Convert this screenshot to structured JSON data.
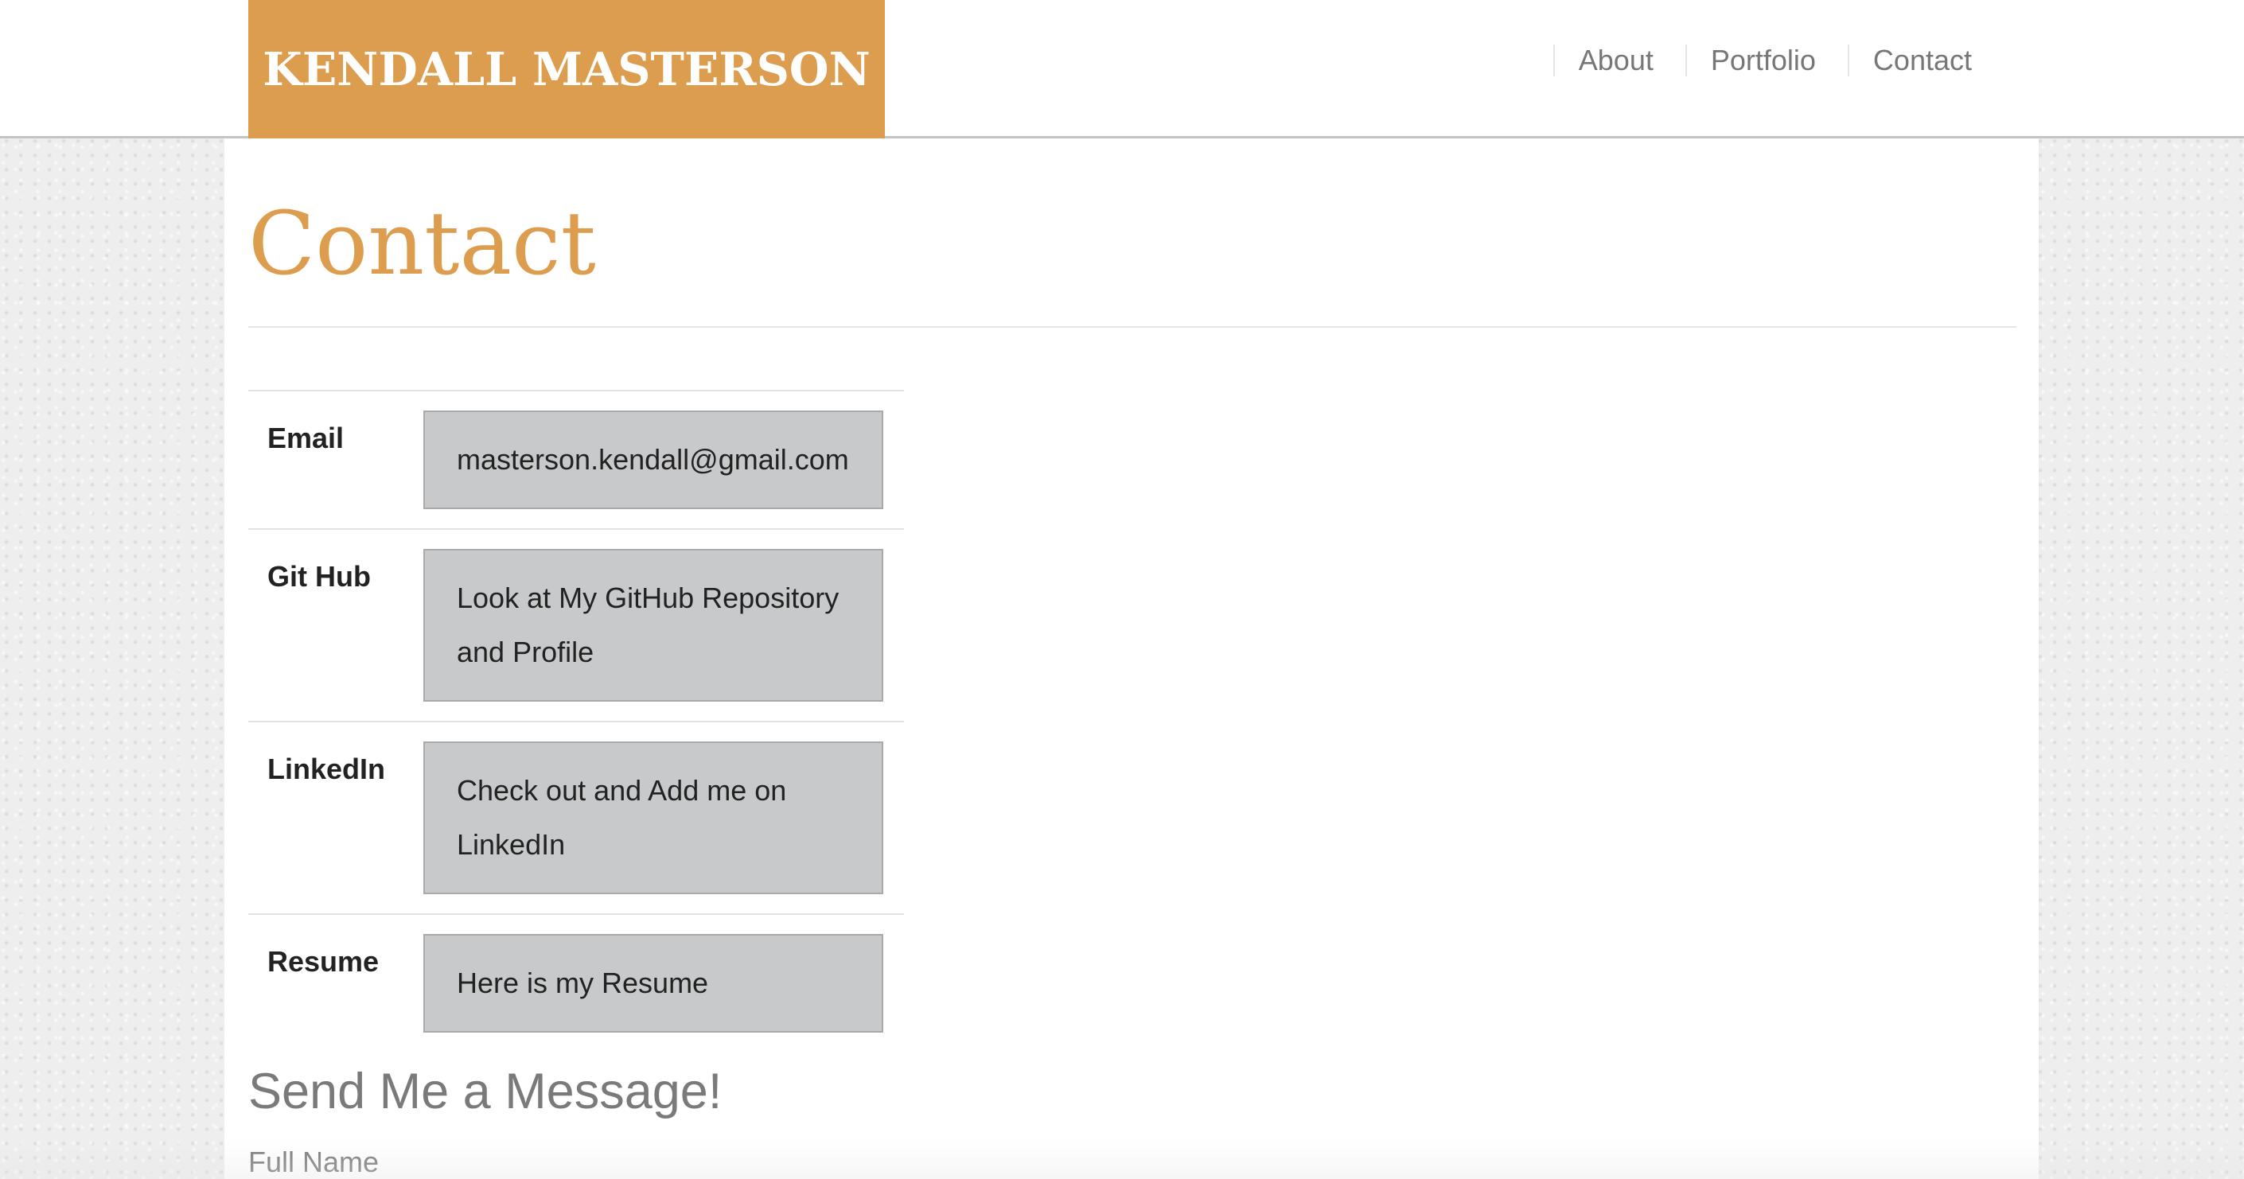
{
  "header": {
    "brand": "KENDALL MASTERSON",
    "nav": [
      {
        "label": "About"
      },
      {
        "label": "Portfolio"
      },
      {
        "label": "Contact"
      }
    ]
  },
  "main": {
    "title": "Contact",
    "contacts": [
      {
        "label": "Email",
        "value": "masterson.kendall@gmail.com"
      },
      {
        "label": "Git Hub",
        "value": "Look at My GitHub Repository and Profile"
      },
      {
        "label": "LinkedIn",
        "value": "Check out and Add me on LinkedIn"
      },
      {
        "label": "Resume",
        "value": "Here is my Resume"
      }
    ],
    "form": {
      "heading": "Send Me a Message!",
      "full_name_label": "Full Name"
    }
  },
  "colors": {
    "accent": "#dc9d4f",
    "link_box": "#c8c9ca",
    "muted_text": "#777777"
  }
}
